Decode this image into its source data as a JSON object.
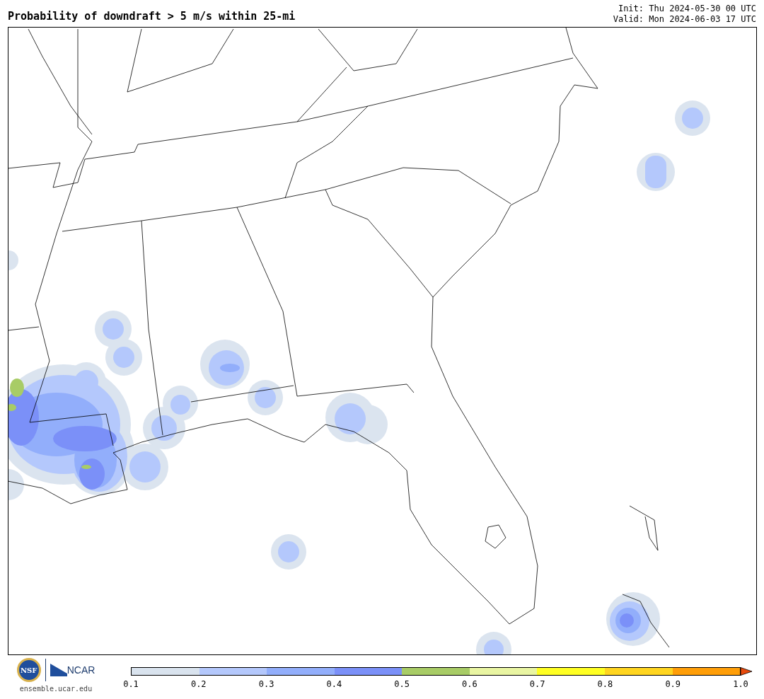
{
  "title": "Probability of downdraft > 5 m/s within 25-mi",
  "init": "Init: Thu 2024-05-30 00 UTC",
  "valid": "Valid: Mon 2024-06-03 17 UTC",
  "logos": {
    "seal": "NSF",
    "wordmark": "NCAR",
    "url": "ensemble.ucar.edu"
  },
  "colorbar": {
    "segments": [
      {
        "color": "#d9e3ee"
      },
      {
        "color": "#b4c8fc"
      },
      {
        "color": "#92aefb"
      },
      {
        "color": "#7b90f8"
      },
      {
        "color": "#a8cc66"
      },
      {
        "color": "#e9f5a2"
      },
      {
        "color": "#ffff22"
      },
      {
        "color": "#ffd520"
      },
      {
        "color": "#ff9e08"
      }
    ],
    "extend": {
      "color": "#e84a0c"
    },
    "ticks": [
      "0.1",
      "0.2",
      "0.3",
      "0.4",
      "0.5",
      "0.6",
      "0.7",
      "0.8",
      "0.9",
      "1.0"
    ]
  }
}
